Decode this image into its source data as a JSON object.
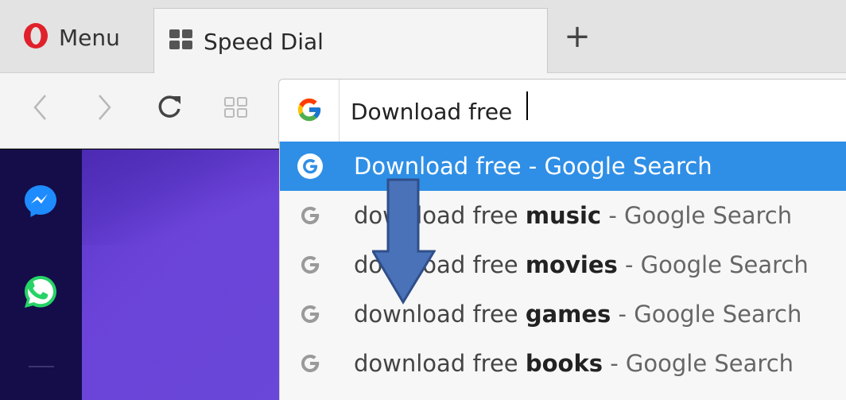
{
  "tabbar": {
    "menu_label": "Menu",
    "tab_label": "Speed Dial",
    "newtab_glyph": "+"
  },
  "toolbar": {
    "address_value": "Download free"
  },
  "suggestions": [
    {
      "prefix": "Download free",
      "bold": "",
      "suffix": " - Google Search",
      "active": true
    },
    {
      "prefix": "download free ",
      "bold": "music",
      "suffix": " - Google Search",
      "active": false
    },
    {
      "prefix": "download free ",
      "bold": "movies",
      "suffix": " - Google Search",
      "active": false
    },
    {
      "prefix": "download free ",
      "bold": "games",
      "suffix": " - Google Search",
      "active": false
    },
    {
      "prefix": "download free ",
      "bold": "books",
      "suffix": " - Google Search",
      "active": false
    }
  ],
  "colors": {
    "opera_red": "#e0202b",
    "highlight_blue": "#2f8fe6",
    "sidebar_bg": "#150d4a",
    "speeddial_purple": "#6a47d8",
    "arrow_fill": "#4a72b8",
    "arrow_stroke": "#2f4f8a"
  },
  "icons": [
    "opera-logo-icon",
    "speed-dial-grid-icon",
    "back-icon",
    "forward-icon",
    "reload-icon",
    "tab-grid-icon",
    "google-g-icon",
    "messenger-icon",
    "whatsapp-icon"
  ]
}
